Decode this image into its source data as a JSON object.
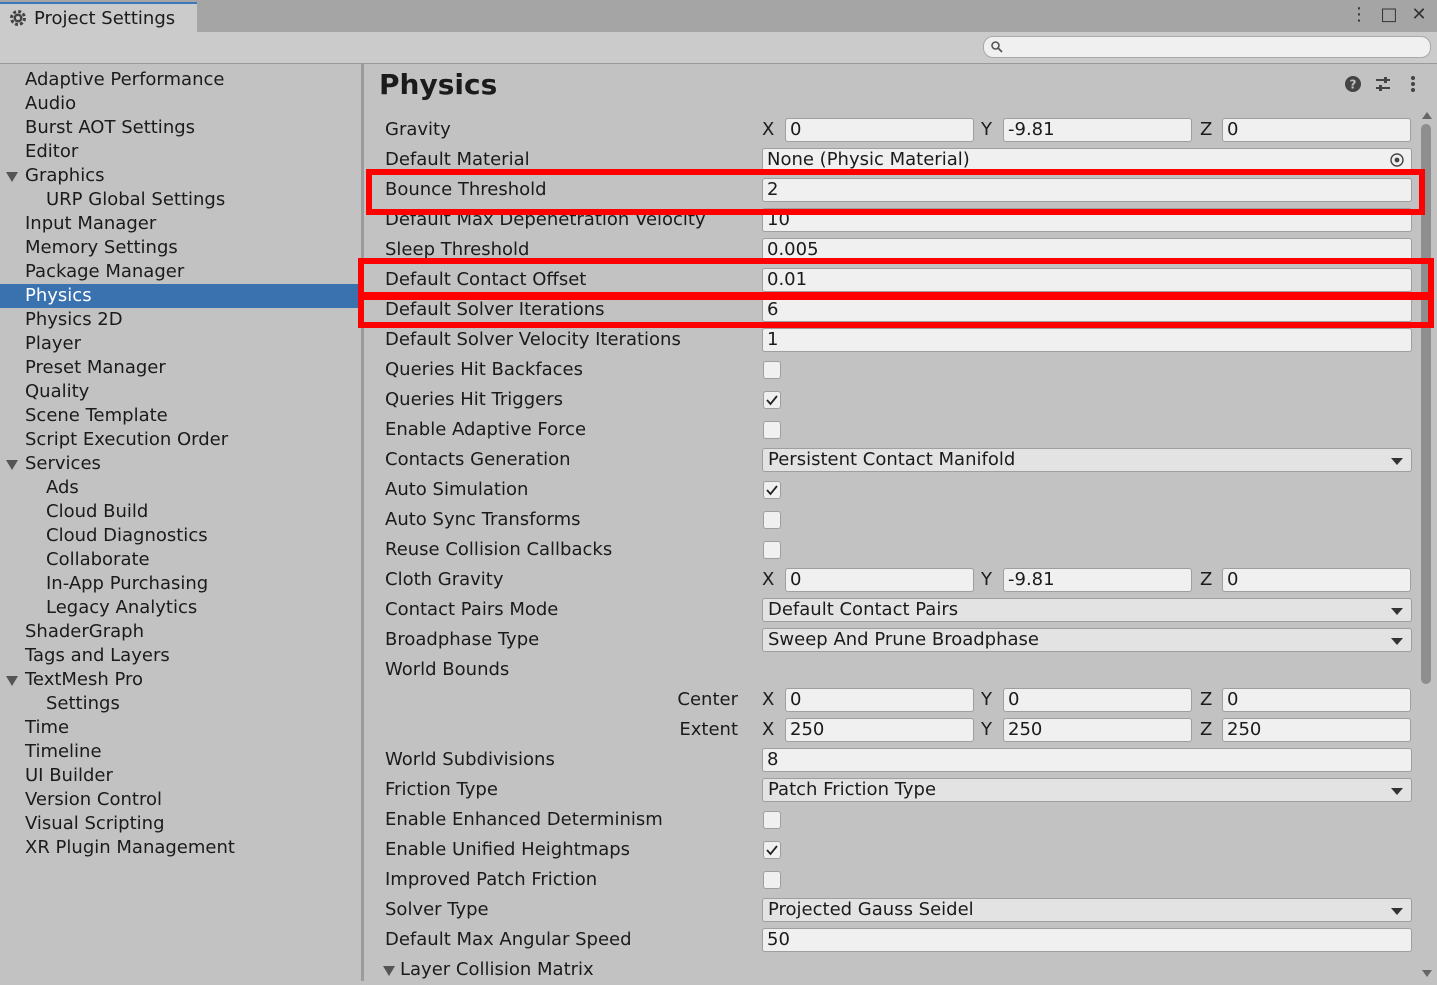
{
  "window": {
    "tab_title": "Project Settings",
    "controls": [
      "more-options",
      "maximize",
      "close"
    ],
    "maximize_glyph": "□",
    "close_glyph": "✕",
    "more_glyph": "⋮"
  },
  "search": {
    "placeholder": "",
    "value": ""
  },
  "sidebar": {
    "items": [
      {
        "label": "Adaptive Performance",
        "level": 0,
        "expanded": null
      },
      {
        "label": "Audio",
        "level": 0,
        "expanded": null
      },
      {
        "label": "Burst AOT Settings",
        "level": 0,
        "expanded": null
      },
      {
        "label": "Editor",
        "level": 0,
        "expanded": null
      },
      {
        "label": "Graphics",
        "level": 0,
        "expanded": true
      },
      {
        "label": "URP Global Settings",
        "level": 1,
        "expanded": null
      },
      {
        "label": "Input Manager",
        "level": 0,
        "expanded": null
      },
      {
        "label": "Memory Settings",
        "level": 0,
        "expanded": null
      },
      {
        "label": "Package Manager",
        "level": 0,
        "expanded": null
      },
      {
        "label": "Physics",
        "level": 0,
        "expanded": null,
        "selected": true
      },
      {
        "label": "Physics 2D",
        "level": 0,
        "expanded": null
      },
      {
        "label": "Player",
        "level": 0,
        "expanded": null
      },
      {
        "label": "Preset Manager",
        "level": 0,
        "expanded": null
      },
      {
        "label": "Quality",
        "level": 0,
        "expanded": null
      },
      {
        "label": "Scene Template",
        "level": 0,
        "expanded": null
      },
      {
        "label": "Script Execution Order",
        "level": 0,
        "expanded": null
      },
      {
        "label": "Services",
        "level": 0,
        "expanded": true
      },
      {
        "label": "Ads",
        "level": 1,
        "expanded": null
      },
      {
        "label": "Cloud Build",
        "level": 1,
        "expanded": null
      },
      {
        "label": "Cloud Diagnostics",
        "level": 1,
        "expanded": null
      },
      {
        "label": "Collaborate",
        "level": 1,
        "expanded": null
      },
      {
        "label": "In-App Purchasing",
        "level": 1,
        "expanded": null
      },
      {
        "label": "Legacy Analytics",
        "level": 1,
        "expanded": null
      },
      {
        "label": "ShaderGraph",
        "level": 0,
        "expanded": null
      },
      {
        "label": "Tags and Layers",
        "level": 0,
        "expanded": null
      },
      {
        "label": "TextMesh Pro",
        "level": 0,
        "expanded": true
      },
      {
        "label": "Settings",
        "level": 1,
        "expanded": null
      },
      {
        "label": "Time",
        "level": 0,
        "expanded": null
      },
      {
        "label": "Timeline",
        "level": 0,
        "expanded": null
      },
      {
        "label": "UI Builder",
        "level": 0,
        "expanded": null
      },
      {
        "label": "Version Control",
        "level": 0,
        "expanded": null
      },
      {
        "label": "Visual Scripting",
        "level": 0,
        "expanded": null
      },
      {
        "label": "XR Plugin Management",
        "level": 0,
        "expanded": null
      }
    ]
  },
  "main": {
    "title": "Physics",
    "header_icons": [
      "help-icon",
      "preset-icon",
      "more-icon"
    ],
    "rows": [
      {
        "label": "Gravity",
        "type": "vector3",
        "x": "0",
        "y": "-9.81",
        "z": "0"
      },
      {
        "label": "Default Material",
        "type": "object",
        "value": "None (Physic Material)"
      },
      {
        "label": "Bounce Threshold",
        "type": "text",
        "value": "2",
        "highlighted": true
      },
      {
        "label": "Default Max Depenetration Velocity",
        "type": "text",
        "value": "10"
      },
      {
        "label": "Sleep Threshold",
        "type": "text",
        "value": "0.005"
      },
      {
        "label": "Default Contact Offset",
        "type": "text",
        "value": "0.01",
        "highlighted": true
      },
      {
        "label": "Default Solver Iterations",
        "type": "text",
        "value": "6",
        "highlighted": true
      },
      {
        "label": "Default Solver Velocity Iterations",
        "type": "text",
        "value": "1"
      },
      {
        "label": "Queries Hit Backfaces",
        "type": "checkbox",
        "checked": false
      },
      {
        "label": "Queries Hit Triggers",
        "type": "checkbox",
        "checked": true
      },
      {
        "label": "Enable Adaptive Force",
        "type": "checkbox",
        "checked": false
      },
      {
        "label": "Contacts Generation",
        "type": "dropdown",
        "value": "Persistent Contact Manifold"
      },
      {
        "label": "Auto Simulation",
        "type": "checkbox",
        "checked": true
      },
      {
        "label": "Auto Sync Transforms",
        "type": "checkbox",
        "checked": false
      },
      {
        "label": "Reuse Collision Callbacks",
        "type": "checkbox",
        "checked": false
      },
      {
        "label": "Cloth Gravity",
        "type": "vector3",
        "x": "0",
        "y": "-9.81",
        "z": "0"
      },
      {
        "label": "Contact Pairs Mode",
        "type": "dropdown",
        "value": "Default Contact Pairs"
      },
      {
        "label": "Broadphase Type",
        "type": "dropdown",
        "value": "Sweep And Prune Broadphase"
      },
      {
        "label": "World Bounds",
        "type": "header"
      },
      {
        "label": "",
        "sublabel": "Center",
        "type": "vector3",
        "x": "0",
        "y": "0",
        "z": "0"
      },
      {
        "label": "",
        "sublabel": "Extent",
        "type": "vector3",
        "x": "250",
        "y": "250",
        "z": "250"
      },
      {
        "label": "World Subdivisions",
        "type": "text",
        "value": "8"
      },
      {
        "label": "Friction Type",
        "type": "dropdown",
        "value": "Patch Friction Type"
      },
      {
        "label": "Enable Enhanced Determinism",
        "type": "checkbox",
        "checked": false
      },
      {
        "label": "Enable Unified Heightmaps",
        "type": "checkbox",
        "checked": true
      },
      {
        "label": "Improved Patch Friction",
        "type": "checkbox",
        "checked": false
      },
      {
        "label": "Solver Type",
        "type": "dropdown",
        "value": "Projected Gauss Seidel"
      },
      {
        "label": "Default Max Angular Speed",
        "type": "text",
        "value": "50"
      },
      {
        "label": "Layer Collision Matrix",
        "type": "foldout"
      }
    ],
    "axis_labels": {
      "x": "X",
      "y": "Y",
      "z": "Z"
    }
  },
  "colors": {
    "selection": "#3a72b0",
    "highlight": "#ff0000",
    "background": "#c2c2c2"
  }
}
